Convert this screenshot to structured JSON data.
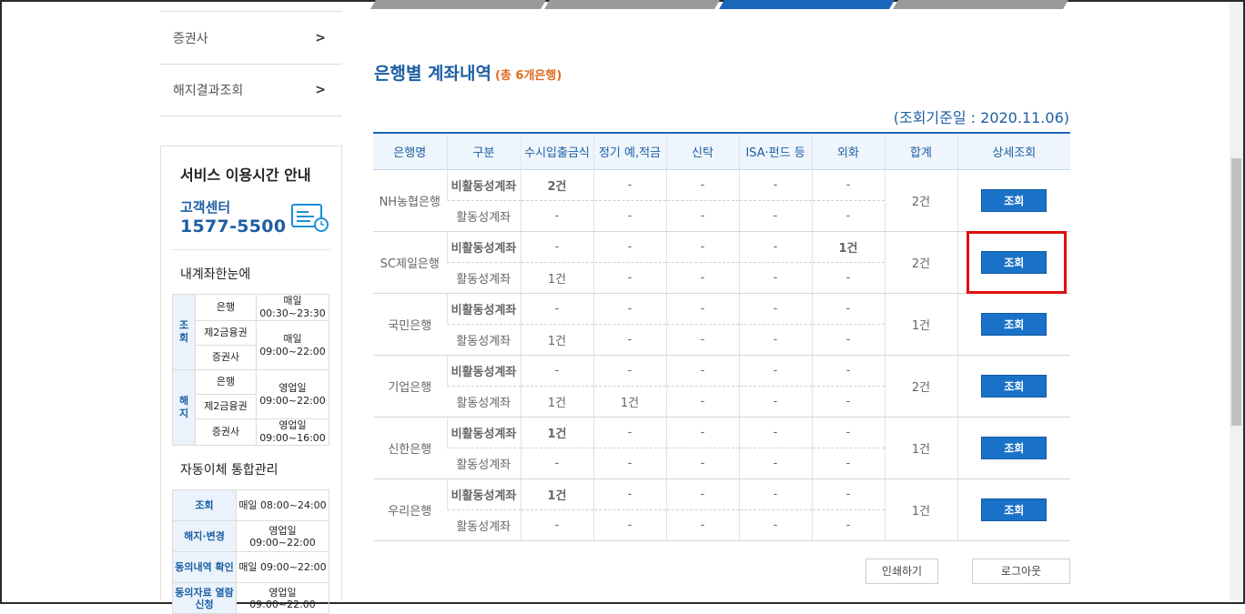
{
  "sidebar": {
    "menu": [
      {
        "label": "증권사"
      },
      {
        "label": "해지결과조회"
      }
    ],
    "guide": {
      "title": "서비스 이용시간 안내",
      "cs_label": "고객센터",
      "cs_number": "1577-5500",
      "account_title": "내계좌한눈에",
      "account_rows": {
        "inquiry": "조회",
        "cancel": "해지",
        "bank": "은행",
        "fin2": "제2금융권",
        "sec": "증권사",
        "inq_bank_time": "매일\n00:30~23:30",
        "inq_other_time": "매일\n09:00~22:00",
        "can_bank_time": "영업일\n09:00~22:00",
        "can_sec_time": "영업일\n09:00~16:00"
      },
      "auto_title": "자동이체 통합관리",
      "auto_rows": [
        {
          "k": "조회",
          "v": "매일 08:00~24:00"
        },
        {
          "k": "해지·변경",
          "v": "영업일 09:00~22:00"
        },
        {
          "k": "동의내역 확인",
          "v": "매일 09:00~22:00"
        },
        {
          "k": "동의자료 열람신청",
          "v": "영업일 09:00~22:00"
        }
      ]
    }
  },
  "main": {
    "title": "은행별 계좌내역",
    "count": "(총 6개은행)",
    "ref_date": "(조회기준일 : 2020.11.06)",
    "headers": [
      "은행명",
      "구분",
      "수시입출금식",
      "정기 예,적금",
      "신탁",
      "ISA·펀드 등",
      "외화",
      "합계",
      "상세조회"
    ],
    "inactive_label": "비활동성계좌",
    "active_label": "활동성계좌",
    "button_label": "조회",
    "banks": [
      {
        "name": "NH농협은행",
        "total": "2건",
        "inactive": [
          "2건",
          "-",
          "-",
          "-",
          "-"
        ],
        "active": [
          "-",
          "-",
          "-",
          "-",
          "-"
        ]
      },
      {
        "name": "SC제일은행",
        "total": "2건",
        "inactive": [
          "-",
          "-",
          "-",
          "-",
          "1건"
        ],
        "active": [
          "1건",
          "-",
          "-",
          "-",
          "-"
        ]
      },
      {
        "name": "국민은행",
        "total": "1건",
        "inactive": [
          "-",
          "-",
          "-",
          "-",
          "-"
        ],
        "active": [
          "1건",
          "-",
          "-",
          "-",
          "-"
        ]
      },
      {
        "name": "기업은행",
        "total": "2건",
        "inactive": [
          "-",
          "-",
          "-",
          "-",
          "-"
        ],
        "active": [
          "1건",
          "1건",
          "-",
          "-",
          "-"
        ]
      },
      {
        "name": "신한은행",
        "total": "1건",
        "inactive": [
          "1건",
          "-",
          "-",
          "-",
          "-"
        ],
        "active": [
          "-",
          "-",
          "-",
          "-",
          "-"
        ]
      },
      {
        "name": "우리은행",
        "total": "1건",
        "inactive": [
          "1건",
          "-",
          "-",
          "-",
          "-"
        ],
        "active": [
          "-",
          "-",
          "-",
          "-",
          "-"
        ]
      }
    ],
    "print_label": "인쇄하기",
    "logout_label": "로그아웃"
  },
  "colors": {
    "accent": "#1d5fa3",
    "button": "#1a72c8",
    "highlight": "#e01010",
    "count": "#e06b20"
  }
}
